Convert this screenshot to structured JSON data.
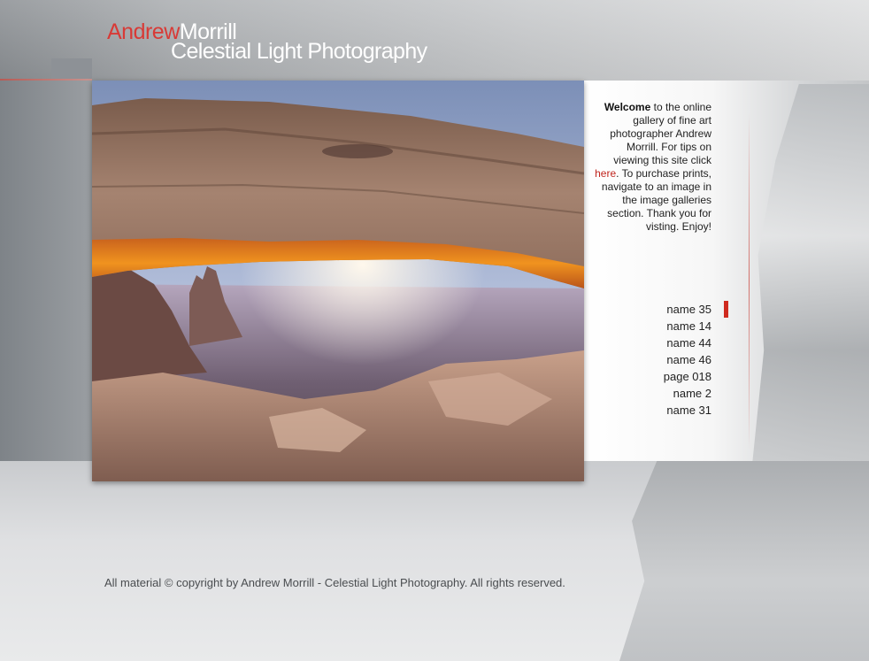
{
  "header": {
    "first_name": "Andrew",
    "last_name": "Morrill",
    "subtitle": "Celestial Light Photography",
    "accent_color": "#d83a36"
  },
  "photo": {
    "subject": "Mesa Arch at sunrise"
  },
  "welcome": {
    "bold": "Welcome",
    "part1": " to the online gallery of fine art photographer Andrew Morrill. For tips on viewing this site click ",
    "link": "here",
    "part2": ". To purchase prints, navigate to an image in the image galleries section. Thank you for visting. Enjoy!"
  },
  "nav": {
    "items": [
      "name 35",
      "name 14",
      "name 44",
      "name 46",
      "page 018",
      "name 2",
      "name 31"
    ],
    "active_index": 0
  },
  "footer": {
    "copyright": "All material © copyright by Andrew Morrill - Celestial Light Photography. All rights reserved."
  }
}
